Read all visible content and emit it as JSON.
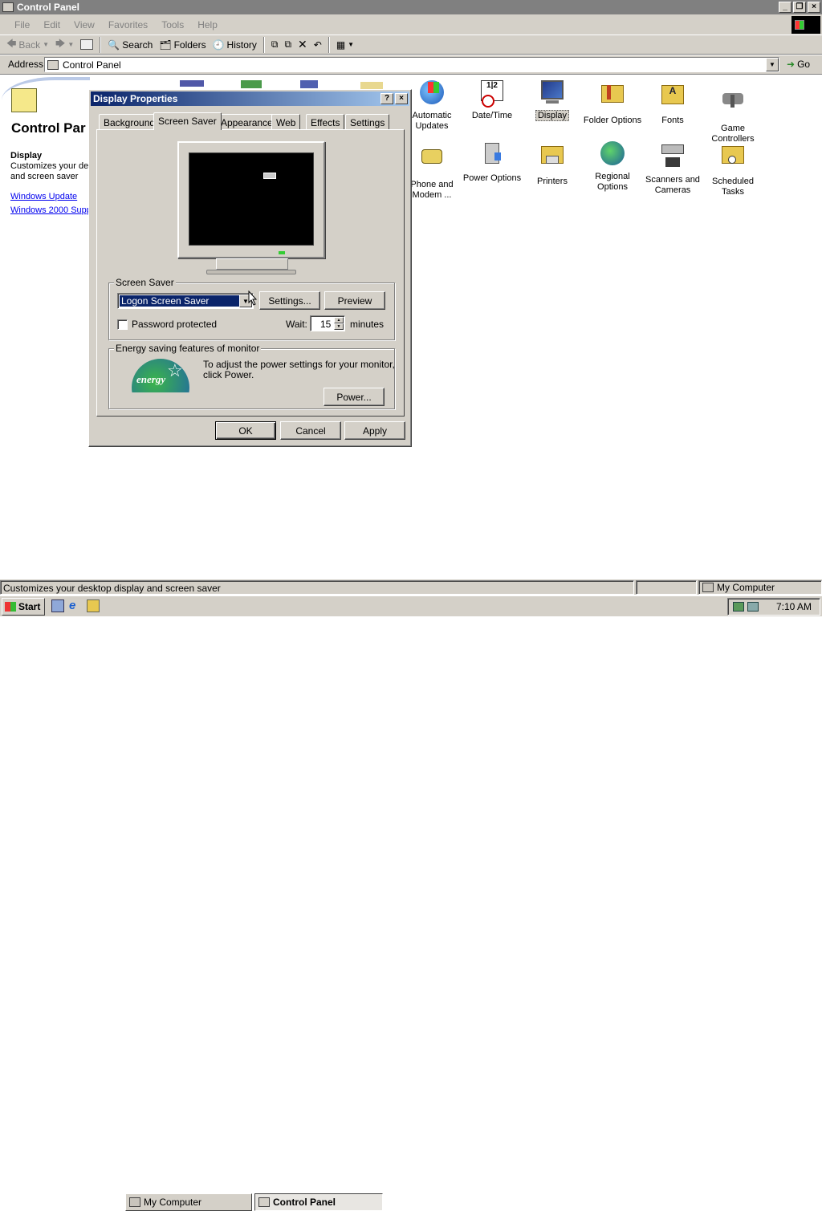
{
  "window": {
    "title": "Control Panel"
  },
  "menu": [
    "File",
    "Edit",
    "View",
    "Favorites",
    "Tools",
    "Help"
  ],
  "toolbar": {
    "back": "Back",
    "search": "Search",
    "folders": "Folders",
    "history": "History"
  },
  "address": {
    "label": "Address",
    "value": "Control Panel",
    "go": "Go"
  },
  "left_panel": {
    "title": "Control Par",
    "section": "Display",
    "desc1": "Customizes your des",
    "desc2": "and screen saver",
    "link1": "Windows Update",
    "link2": "Windows 2000 Supp"
  },
  "icons": [
    {
      "name": "automatic-updates",
      "l1": "Automatic",
      "l2": "Updates"
    },
    {
      "name": "date-time",
      "l1": "Date/Time",
      "l2": ""
    },
    {
      "name": "display",
      "l1": "Display",
      "l2": ""
    },
    {
      "name": "folder-options",
      "l1": "Folder Options",
      "l2": ""
    },
    {
      "name": "fonts",
      "l1": "Fonts",
      "l2": ""
    },
    {
      "name": "game-controllers",
      "l1": "Game",
      "l2": "Controllers"
    },
    {
      "name": "phone-modem",
      "l1": "Phone and",
      "l2": "Modem ..."
    },
    {
      "name": "power-options",
      "l1": "Power Options",
      "l2": ""
    },
    {
      "name": "printers",
      "l1": "Printers",
      "l2": ""
    },
    {
      "name": "regional-options",
      "l1": "Regional",
      "l2": "Options"
    },
    {
      "name": "scanners-cameras",
      "l1": "Scanners and",
      "l2": "Cameras"
    },
    {
      "name": "scheduled-tasks",
      "l1": "Scheduled",
      "l2": "Tasks"
    }
  ],
  "dialog": {
    "title": "Display Properties",
    "help": "?",
    "tabs": [
      "Background",
      "Screen Saver",
      "Appearance",
      "Web",
      "Effects",
      "Settings"
    ],
    "screensaver_group": "Screen Saver",
    "screensaver_value": "Logon Screen Saver",
    "settings_btn": "Settings...",
    "preview_btn": "Preview",
    "password_label": "Password protected",
    "wait_label": "Wait:",
    "wait_value": "15",
    "minutes": "minutes",
    "energy_group": "Energy saving features of monitor",
    "energy_text1": "To adjust the power settings for your monitor,",
    "energy_text2": "click Power.",
    "power_btn": "Power...",
    "energy_logo": "energy",
    "ok": "OK",
    "cancel": "Cancel",
    "apply": "Apply"
  },
  "status": {
    "text": "Customizes your desktop display and screen saver",
    "zone": "My Computer"
  },
  "taskbar": {
    "start": "Start",
    "task1": "My Computer",
    "task2": "Control Panel",
    "clock": "7:10 AM"
  }
}
